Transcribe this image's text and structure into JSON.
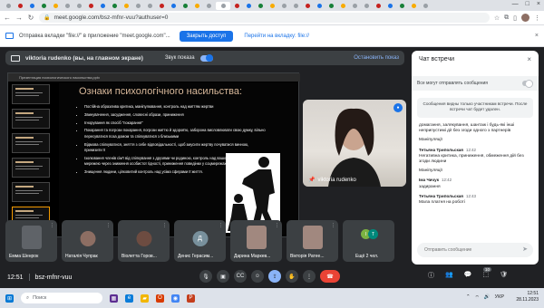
{
  "browser": {
    "url": "meet.google.com/bsz-mfnr-vuu?authuser=0",
    "tabs": [
      "",
      "",
      "",
      "",
      "",
      "",
      "",
      "",
      "",
      "",
      "",
      "",
      "",
      "",
      "",
      "",
      "",
      "",
      "",
      "",
      "",
      "",
      "",
      "",
      "",
      "",
      "",
      "",
      "",
      "",
      "",
      "",
      "",
      "",
      "",
      ""
    ],
    "active_tab_title": "",
    "close_glyph": "×",
    "window_controls": [
      "—",
      "□",
      "×"
    ]
  },
  "infobar": {
    "text": "Отправка вкладки \"file://\" в приложение \"meet.google.com\"...",
    "stop_button": "Закрыть доступ",
    "switch_link": "Перейти на вкладку: file://"
  },
  "presentation": {
    "presenter_label": "viktoria rudenko (вы, на главном экране)",
    "sound_label": "Звук показа",
    "stop_label": "Остановить показ",
    "app_titlebar": "Презентация психологического насильства.pptx"
  },
  "slide": {
    "title": "Ознаки психологічного насильства:",
    "bullets": [
      "Постійна образлива критика, маніпулювання, контроль над життям жертви",
      "Звинувачення, засудження, словесні образи, приниження",
      "Ігнорування як спосіб \"покарання\"",
      "Покарання та погрози покарання, погрози життю й здоров'ю, заборона висловлювати свою думку, вільно пересуватися поза домом та спілкуватися з близькими",
      "Відмова спілкуватися, зняття з себе відповідальності, щоб змусити жертву почуватися винною, принизити її",
      "Ізолювання членів сім'ї від спілкування з друзями чи родиною, контроль над вашою соціальною мережею через зниження особистої гідності, приниження поведінки у соцмережах",
      "Знищення людини, цілковитий контроль над усіма сферами її життя."
    ]
  },
  "speaker": {
    "name": "viktoria rudenko",
    "pin_icon": "pin-icon"
  },
  "participants": [
    {
      "name": "Емма Шенрок",
      "initial": "",
      "color": "#5f6368",
      "video": true
    },
    {
      "name": "Наталія Чупрак",
      "initial": "",
      "color": "#8d6e63",
      "video": false
    },
    {
      "name": "Віолетта Горов...",
      "initial": "",
      "color": "#6d4c41",
      "video": false
    },
    {
      "name": "Денис Герасим...",
      "initial": "Д",
      "color": "#78909c",
      "video": false
    },
    {
      "name": "Дарина Маркев...",
      "initial": "",
      "color": "#a1887f",
      "video": true
    },
    {
      "name": "Вікторія Ратее...",
      "initial": "",
      "color": "#a1887f",
      "video": true
    },
    {
      "name": "Ещё 2 чел.",
      "initial": "",
      "color": "#3c4043",
      "video": false,
      "more": true,
      "avatars": [
        "I",
        "T"
      ]
    }
  ],
  "controls": {
    "time": "12:51",
    "meeting_code": "bsz-mfnr-vuu",
    "participant_count": "10",
    "buttons": [
      "mic-icon",
      "camera-icon",
      "captions-icon",
      "emoji-icon",
      "present-icon",
      "raise-hand-icon",
      "more-icon",
      "end-call-icon"
    ],
    "right_buttons": [
      "info-icon",
      "people-icon",
      "chat-icon",
      "activities-icon",
      "shield-icon"
    ]
  },
  "chat": {
    "title": "Чат встречи",
    "close_glyph": "×",
    "toggle_label": "Все могут отправлять сообщения",
    "notice": "Сообщения видны только участникам встречи. После встречи чат будет удален.",
    "messages": [
      {
        "who": "",
        "when": "",
        "text": "домагання, залякування, шантаж і будь-які інші неприпустимі дії без згоди одного з партнерів"
      },
      {
        "who": "",
        "when": "",
        "text": "Маніпуляції"
      },
      {
        "who": "Тетьяна Трипольская",
        "when": "12:42",
        "text": "Негативна критика, приниження, обмеження дій без згоди людини"
      },
      {
        "who": "",
        "when": "",
        "text": "Маніпуляції"
      },
      {
        "who": "Іма Чичук",
        "when": "12:42",
        "text": "задирання"
      },
      {
        "who": "Тетьяна Трипольская",
        "when": "12:43",
        "text": "Мала платня на роботі"
      }
    ],
    "input_placeholder": "Отправить сообщение",
    "send_glyph": "➤"
  },
  "taskbar": {
    "search_text": "Поиск",
    "lang": "УКР",
    "time": "12:51",
    "date": "28.11.2023"
  }
}
